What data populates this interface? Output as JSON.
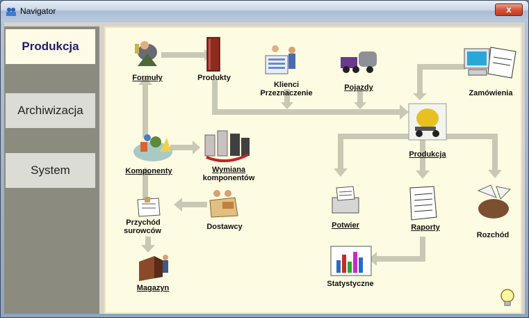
{
  "window": {
    "title": "Navigator",
    "close_symbol": "x"
  },
  "sidebar": {
    "items": [
      {
        "label": "Produkcja",
        "active": true
      },
      {
        "label": "Archiwizacja",
        "active": false
      },
      {
        "label": "System",
        "active": false
      }
    ]
  },
  "nodes": {
    "formuly": "Formuły",
    "produkty": "Produkty",
    "klienci_1": "Klienci",
    "klienci_2": "Przeznaczenie",
    "pojazdy": "Pojazdy",
    "zamowienia": "Zamówienia",
    "produkcja": "Produkcja",
    "komponenty": "Komponenty",
    "wymiana_1": "Wymiana",
    "wymiana_2": "komponentów",
    "przychod_1": "Przychód",
    "przychod_2": "surowców",
    "dostawcy": "Dostawcy",
    "potwier": "Potwier",
    "raporty": "Raporty",
    "rozchod": "Rozchód",
    "statystyczne": "Statystyczne",
    "magazyn": "Magazyn"
  },
  "colors": {
    "arrow": "#c8c8b4",
    "canvas": "#fdfbe2",
    "active_tab": "#fffbe6"
  }
}
